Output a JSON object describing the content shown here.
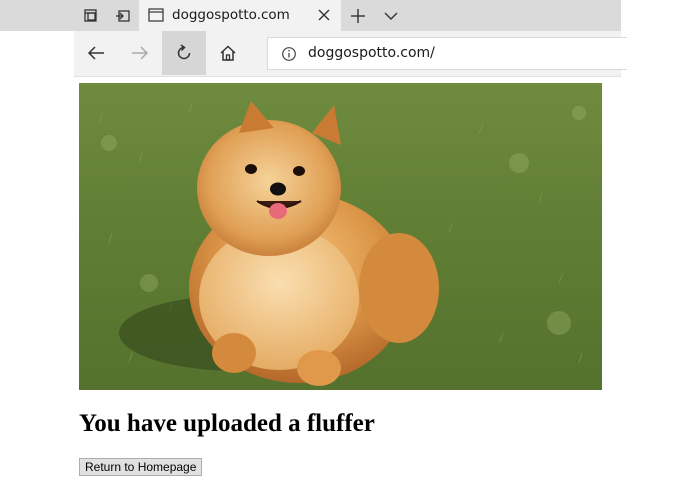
{
  "browser": {
    "tab": {
      "title": "doggospotto.com"
    },
    "address_bar": {
      "url": "doggospotto.com/"
    },
    "icons": {
      "tab_manager": "tabs-aside-icon",
      "tab_restore": "restore-tabs-icon",
      "favicon": "page-icon",
      "close": "close-icon",
      "new_tab": "plus-icon",
      "tab_list": "chevron-down-icon",
      "back": "back-arrow-icon",
      "forward": "forward-arrow-icon",
      "refresh": "refresh-icon",
      "home": "home-icon",
      "site_info": "info-icon"
    }
  },
  "page": {
    "heading": "You have uploaded a fluffer",
    "return_button_label": "Return to Homepage",
    "image": {
      "subject": "pomeranian-dog-on-grass"
    }
  },
  "colors": {
    "tabstrip_bg": "#dadada",
    "active_tab_bg": "#f2f2f2",
    "navbar_bg": "#f2f2f2",
    "active_nav_btn_bg": "#d6d6d6",
    "grass": "#5e7a34",
    "dog_fur": "#d98a3a"
  }
}
